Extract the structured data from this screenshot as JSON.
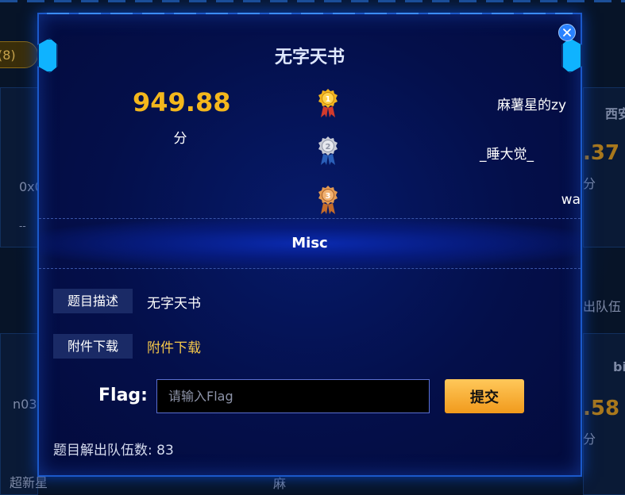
{
  "background": {
    "pill_text": "(8)",
    "left_texts": [
      "0x0",
      "--",
      "n03",
      "超新星"
    ],
    "right_texts": [
      "西安",
      "分",
      "出队伍",
      "bi",
      "分"
    ],
    "right_scores": [
      ".37",
      ".58"
    ],
    "bottom_texts": [
      "麻"
    ]
  },
  "modal": {
    "title": "无字天书",
    "score": {
      "value": "949.88",
      "unit": "分"
    },
    "ranking": [
      {
        "rank": "1",
        "medal": "gold-medal",
        "name": "麻薯星的zy"
      },
      {
        "rank": "2",
        "medal": "silver-medal",
        "name": "_睡大觉_"
      },
      {
        "rank": "3",
        "medal": "bronze-medal",
        "name": "wa"
      }
    ],
    "category": "Misc",
    "description": {
      "label": "题目描述",
      "value": "无字天书"
    },
    "attachment": {
      "label": "附件下载",
      "link_text": "附件下载"
    },
    "flag": {
      "label": "Flag:",
      "placeholder": "请输入Flag",
      "value": ""
    },
    "submit_label": "提交",
    "solves_label": "题目解出队伍数:",
    "solves_count": "83",
    "colors": {
      "accent_gold": "#f4b71c",
      "link_gold": "#f7c94a",
      "border_blue": "#1b59c9",
      "close_blue": "#2a82ff"
    }
  }
}
